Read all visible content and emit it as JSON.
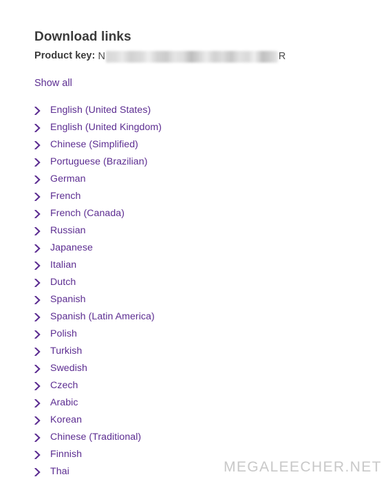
{
  "page": {
    "title": "Download links",
    "product_key": {
      "label": "Product key:",
      "visible_prefix": "N",
      "visible_suffix": "R",
      "redacted": true
    },
    "show_all_label": "Show all"
  },
  "languages": [
    {
      "label": "English (United States)",
      "icon": "chevron-right-icon"
    },
    {
      "label": "English (United Kingdom)",
      "icon": "chevron-right-icon"
    },
    {
      "label": "Chinese (Simplified)",
      "icon": "chevron-right-icon"
    },
    {
      "label": "Portuguese (Brazilian)",
      "icon": "chevron-right-icon"
    },
    {
      "label": "German",
      "icon": "chevron-right-icon"
    },
    {
      "label": "French",
      "icon": "chevron-right-icon"
    },
    {
      "label": "French (Canada)",
      "icon": "chevron-right-icon"
    },
    {
      "label": "Russian",
      "icon": "chevron-right-icon"
    },
    {
      "label": "Japanese",
      "icon": "chevron-right-icon"
    },
    {
      "label": "Italian",
      "icon": "chevron-right-icon"
    },
    {
      "label": "Dutch",
      "icon": "chevron-right-icon"
    },
    {
      "label": "Spanish",
      "icon": "chevron-right-icon"
    },
    {
      "label": "Spanish (Latin America)",
      "icon": "chevron-right-icon"
    },
    {
      "label": "Polish",
      "icon": "chevron-right-icon"
    },
    {
      "label": "Turkish",
      "icon": "chevron-right-icon"
    },
    {
      "label": "Swedish",
      "icon": "chevron-right-icon"
    },
    {
      "label": "Czech",
      "icon": "chevron-right-icon"
    },
    {
      "label": "Arabic",
      "icon": "chevron-right-icon"
    },
    {
      "label": "Korean",
      "icon": "chevron-right-icon"
    },
    {
      "label": "Chinese (Traditional)",
      "icon": "chevron-right-icon"
    },
    {
      "label": "Finnish",
      "icon": "chevron-right-icon"
    },
    {
      "label": "Thai",
      "icon": "chevron-right-icon"
    }
  ],
  "watermark": {
    "text": "MEGALEECHER.NET"
  },
  "colors": {
    "link": "#5c2d91",
    "heading": "#3b3b3b",
    "watermark": "#c8c8c8",
    "background": "#ffffff"
  }
}
